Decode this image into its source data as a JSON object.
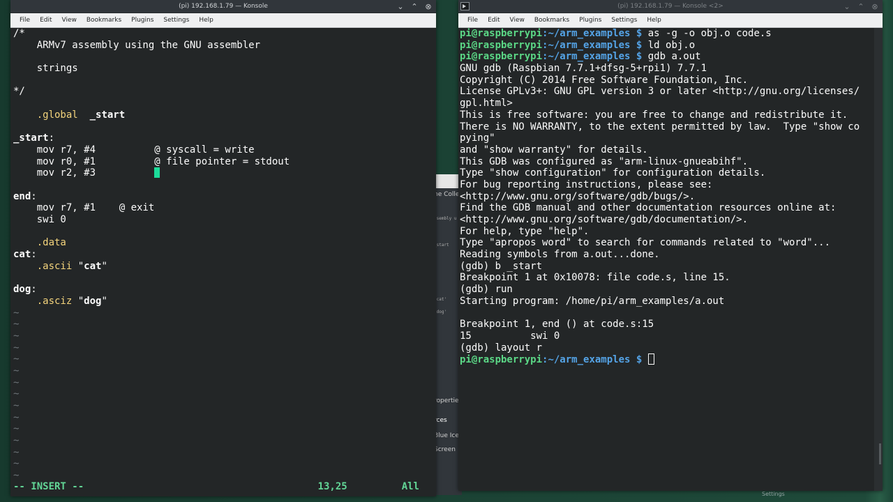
{
  "left_window": {
    "title": "(pi) 192.168.1.79 — Konsole",
    "menu": [
      "File",
      "Edit",
      "View",
      "Bookmarks",
      "Plugins",
      "Settings",
      "Help"
    ],
    "editor_lines": [
      "/*",
      "    ARMv7 assembly using the GNU assembler",
      "",
      "    strings",
      "",
      "*/",
      "",
      "    .global  _start",
      "",
      "_start:",
      "    mov r7, #4          @ syscall = write",
      "    mov r0, #1          @ file pointer = stdout",
      "    mov r2, #3          ",
      "",
      "end:",
      "    mov r7, #1    @ exit",
      "    swi 0",
      "",
      "    .data",
      "cat:",
      "    .ascii \"cat\"",
      "",
      "dog:",
      "    .asciz \"dog\"",
      "~",
      "~",
      "~",
      "~",
      "~",
      "~",
      "~",
      "~",
      "~",
      "~",
      "~",
      "~",
      "~",
      "~",
      "~"
    ],
    "status_mode": "-- INSERT --",
    "status_position": "13,25",
    "status_scroll": "All"
  },
  "right_window": {
    "title": "(pi) 192.168.1.79 — Konsole <2>",
    "menu": [
      "File",
      "Edit",
      "View",
      "Bookmarks",
      "Plugins",
      "Settings",
      "Help"
    ],
    "prompt_user": "pi@raspberrypi",
    "prompt_path": ":~/arm_examples",
    "prompt_symbol": " $ ",
    "commands": [
      "as -g -o obj.o code.s",
      "ld obj.o",
      "gdb a.out"
    ],
    "output_lines": [
      "GNU gdb (Raspbian 7.7.1+dfsg-5+rpi1) 7.7.1",
      "Copyright (C) 2014 Free Software Foundation, Inc.",
      "License GPLv3+: GNU GPL version 3 or later <http://gnu.org/licenses/",
      "gpl.html>",
      "This is free software: you are free to change and redistribute it.",
      "There is NO WARRANTY, to the extent permitted by law.  Type \"show co",
      "pying\"",
      "and \"show warranty\" for details.",
      "This GDB was configured as \"arm-linux-gnueabihf\".",
      "Type \"show configuration\" for configuration details.",
      "For bug reporting instructions, please see:",
      "<http://www.gnu.org/software/gdb/bugs/>.",
      "Find the GDB manual and other documentation resources online at:",
      "<http://www.gnu.org/software/gdb/documentation/>.",
      "For help, type \"help\".",
      "Type \"apropos word\" to search for commands related to \"word\"...",
      "Reading symbols from a.out...done.",
      "(gdb) b _start",
      "Breakpoint 1 at 0x10078: file code.s, line 15.",
      "(gdb) run",
      "Starting program: /home/pi/arm_examples/a.out",
      "",
      "Breakpoint 1, end () at code.s:15",
      "15          swi 0",
      "(gdb) layout r"
    ]
  },
  "background_window": {
    "labels": [
      "ne Colle",
      "ssembly u",
      "_start",
      "'cat'",
      "'dog'",
      "ropertie",
      "rces",
      "Blue Ice",
      "Screen",
      "Settings"
    ]
  },
  "colors": {
    "terminal_bg": "#232627",
    "prompt_green": "#5bd786",
    "path_blue": "#54a3e6",
    "directive_yellow": "#f4d47c",
    "status_green": "#62d596",
    "cursor": "#1cdc9a"
  },
  "icons": [
    "konsole-icon",
    "minimize-icon",
    "maximize-icon",
    "close-icon"
  ]
}
